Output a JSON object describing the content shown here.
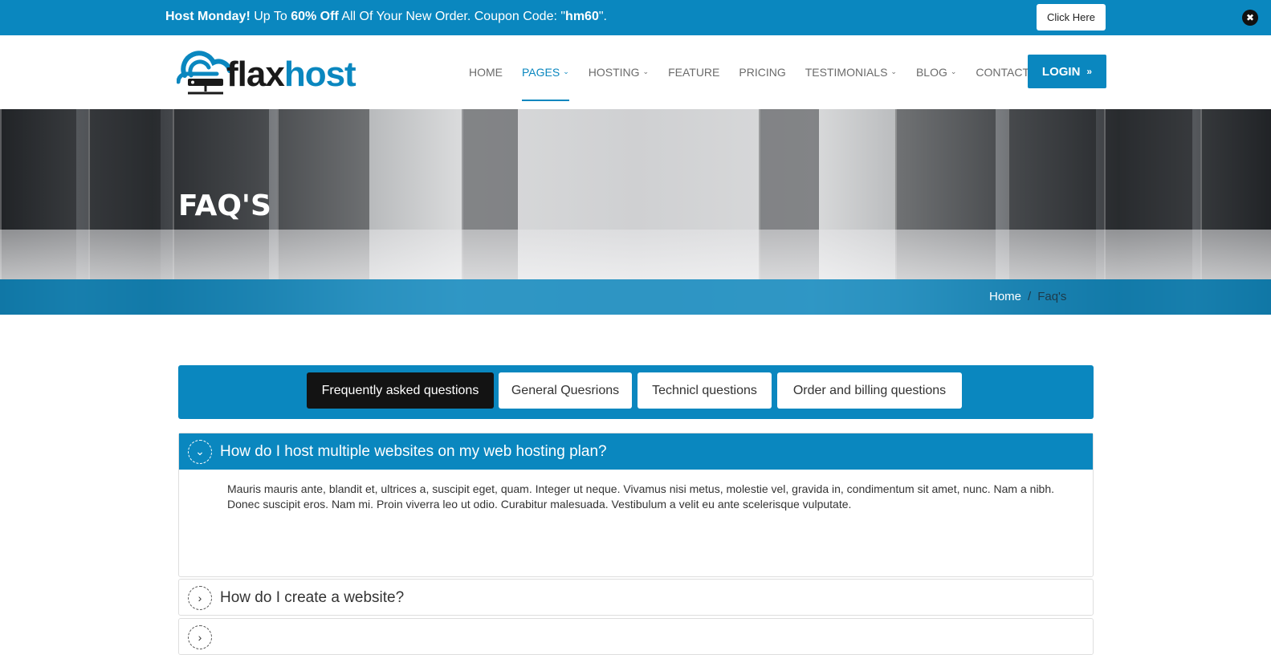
{
  "promo": {
    "lead": "Host Monday!",
    "part1": " Up To ",
    "discount": "60% Off",
    "part2": " All Of Your New Order. Coupon Code: \"",
    "code": "hm60",
    "part3": "\".",
    "button": "Click Here",
    "close_icon": "✖"
  },
  "header": {
    "logo_part1": "flax",
    "logo_part2": "host",
    "nav": [
      {
        "label": "HOME",
        "caret": ""
      },
      {
        "label": "PAGES",
        "caret": "⌄"
      },
      {
        "label": "HOSTING",
        "caret": "⌄"
      },
      {
        "label": "FEATURE",
        "caret": ""
      },
      {
        "label": "PRICING",
        "caret": ""
      },
      {
        "label": "TESTIMONIALS",
        "caret": "⌄"
      },
      {
        "label": "BLOG",
        "caret": "⌄"
      },
      {
        "label": "CONTACT",
        "caret": ""
      }
    ],
    "login": "LOGIN",
    "login_icon": "»"
  },
  "hero": {
    "title": "FAQ'S",
    "breadcrumb_home": "Home",
    "breadcrumb_sep": "/",
    "breadcrumb_current": "Faq's"
  },
  "tabs": [
    "Frequently asked questions",
    "General Quesrions",
    "Technicl questions",
    "Order and billing questions"
  ],
  "faq": [
    {
      "question": "How do I host multiple websites on my web hosting plan?",
      "answer": "Mauris mauris ante, blandit et, ultrices a, suscipit eget, quam. Integer ut neque. Vivamus nisi metus, molestie vel, gravida in, condimentum sit amet, nunc. Nam a nibh. Donec suscipit eros. Nam mi. Proin viverra leo ut odio. Curabitur malesuada. Vestibulum a velit eu ante scelerisque vulputate.",
      "icon": "⌄"
    },
    {
      "question": "How do I create a website?",
      "icon": "›"
    },
    {
      "question": "",
      "icon": "›"
    }
  ],
  "colors": {
    "brand": "#0a87bf",
    "dark": "#131313"
  }
}
